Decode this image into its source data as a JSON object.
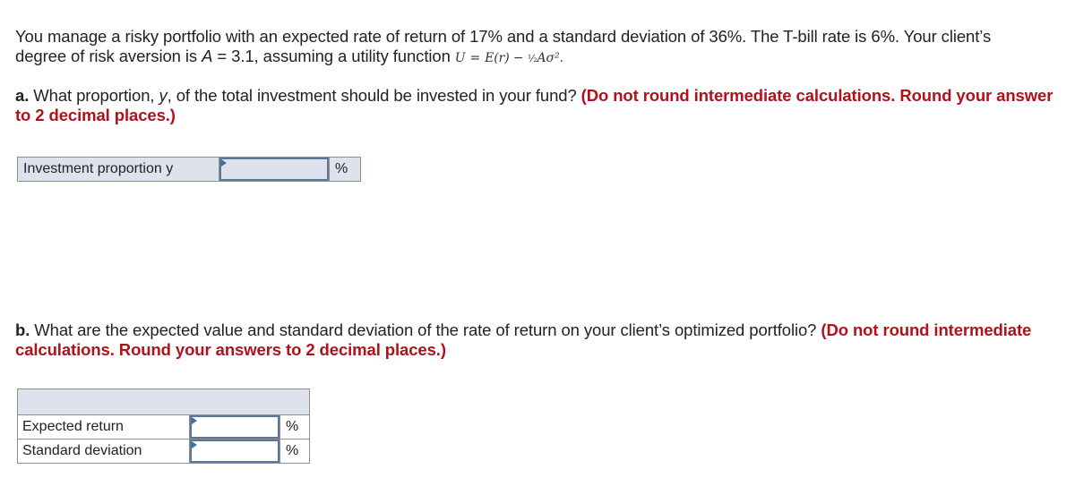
{
  "intro": {
    "sentence1": "You manage a risky portfolio with an expected rate of return of 17% and a standard deviation of 36%. The T-bill rate is 6%. Your client’s",
    "sentence2_pre": "degree of risk aversion is ",
    "var_A": "A",
    "eq_A": " = 3.1, assuming a utility function ",
    "formula": {
      "U": "U",
      "equals": "=",
      "rhs": "E(r) − ",
      "half": "½",
      "tail": "Aσ².",
      "note": ""
    }
  },
  "question_a": {
    "letter": "a.",
    "text_pre": " What proportion, ",
    "var_y": "y",
    "text_post": ", of the total investment should be invested in your fund? ",
    "instruction": "(Do not round intermediate calculations. Round your answer to 2 decimal places.)"
  },
  "table_a": {
    "rows": [
      {
        "label": "Investment proportion y",
        "value": "",
        "unit": "%"
      }
    ]
  },
  "question_b": {
    "letter": "b.",
    "text": " What are the expected value and standard deviation of the rate of return on your client’s optimized portfolio? ",
    "instruction": "(Do not round intermediate calculations. Round your answers to 2 decimal places.)"
  },
  "table_b": {
    "header": "",
    "rows": [
      {
        "label": "Expected return",
        "value": "",
        "unit": "%"
      },
      {
        "label": "Standard deviation",
        "value": "",
        "unit": "%"
      }
    ]
  },
  "colors": {
    "instruction_red": "#b0121b",
    "table_fill": "#dde2ec",
    "input_border": "#5d7896",
    "flag_blue": "#3b6ea5"
  }
}
